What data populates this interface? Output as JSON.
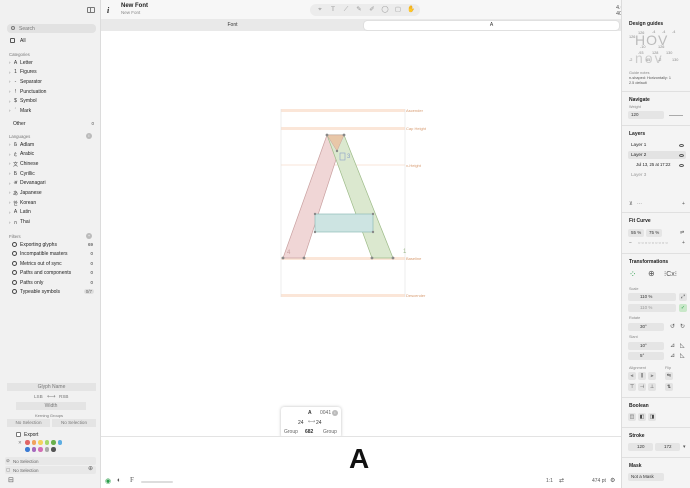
{
  "window": {
    "doc_title": "New Font",
    "doc_subtitle": "New Font",
    "zoom_range": "4.0-400%"
  },
  "tabs": [
    {
      "label": "Font"
    },
    {
      "label": "A"
    }
  ],
  "sidebar": {
    "search_placeholder": "Search",
    "all_label": "All",
    "categories_title": "Categories",
    "categories": [
      {
        "icon": "A",
        "label": "Letter"
      },
      {
        "icon": "1",
        "label": "Figures"
      },
      {
        "icon": "-",
        "label": "Separator"
      },
      {
        "icon": "!",
        "label": "Punctuation"
      },
      {
        "icon": "$",
        "label": "Symbol"
      },
      {
        "icon": "´",
        "label": "Mark"
      }
    ],
    "other_label": "Other",
    "other_count": "0",
    "languages_title": "Languages",
    "languages": [
      {
        "icon": "𞤀",
        "label": "Adlam"
      },
      {
        "icon": "ع",
        "label": "Arabic"
      },
      {
        "icon": "文",
        "label": "Chinese"
      },
      {
        "icon": "Б",
        "label": "Cyrillic"
      },
      {
        "icon": "अ",
        "label": "Devanagari"
      },
      {
        "icon": "あ",
        "label": "Japanese"
      },
      {
        "icon": "한",
        "label": "Korean"
      },
      {
        "icon": "A",
        "label": "Latin"
      },
      {
        "icon": "ก",
        "label": "Thai"
      }
    ],
    "filters_title": "Filters",
    "filters": [
      {
        "label": "Exporting glyphs",
        "count": "69"
      },
      {
        "label": "Incompatible masters",
        "count": "0"
      },
      {
        "label": "Metrics out of sync",
        "count": "0"
      },
      {
        "label": "Paths and components",
        "count": "0"
      },
      {
        "label": "Paths only",
        "count": "0"
      },
      {
        "label": "Typeable symbols",
        "count": "0/7"
      }
    ],
    "glyph_name_placeholder": "Glyph Name",
    "lsb_label": "LSB",
    "rsb_label": "RSB",
    "width_label": "Width",
    "kerning_groups_label": "Kerning Groups",
    "kerning_left": "No Selection",
    "kerning_right": "No Selection",
    "export_label": "Export",
    "swatch_colors": [
      "#e06666",
      "#f0a35e",
      "#f4d35e",
      "#a6d96a",
      "#6ab04c",
      "#5dade2",
      "#3b7bd4",
      "#a569bd",
      "#d46fb4",
      "#aaaaaa",
      "#555555"
    ],
    "no_selection_1": "No Selection",
    "no_selection_2": "No Selection"
  },
  "canvas": {
    "metrics": [
      {
        "label": "Ascender"
      },
      {
        "label": "Cap Height"
      },
      {
        "label": "x-Height"
      },
      {
        "label": "Baseline"
      },
      {
        "label": "Descender"
      }
    ],
    "node_label_1": "1",
    "node_label_2": "3",
    "node_label_3": "4"
  },
  "glyph_card": {
    "glyph": "A",
    "unicode": "0041",
    "lsb": "24",
    "rsb": "24",
    "left_group": "Group",
    "width": "682",
    "right_group": "Group"
  },
  "preview": {
    "glyph": "A",
    "size_label": "474 pt",
    "scale": "1:1"
  },
  "inspector": {
    "design_guides_title": "Design guides",
    "guides_sample_top": "HOV",
    "guides_sample_bottom": "nov",
    "guide_numbers": [
      "126",
      "126",
      "-4",
      "-4",
      "-4",
      "-10",
      "126",
      "-93",
      "128",
      "130",
      "-2",
      "45",
      "-2",
      "130"
    ],
    "guide_notes": [
      "Guide notes",
      "n-shaped: Horizontally: 1",
      "2.5 default"
    ],
    "navigate_title": "Navigate",
    "weight_label": "Weight",
    "weight_value": "120",
    "layers_title": "Layers",
    "layers": [
      {
        "label": "Layer 1"
      },
      {
        "label": "Layer 2"
      },
      {
        "label": "Jul 13, 25 at 17:22"
      },
      {
        "label": "Layer 3"
      }
    ],
    "fit_curve_title": "Fit Curve",
    "fit_curve_values": [
      "55 %",
      "75 %"
    ],
    "transformations_title": "Transformations",
    "scale_label": "Scale",
    "scale_values": [
      "110 %",
      "110 %"
    ],
    "rotate_label": "Rotate",
    "rotate_value": "30°",
    "slant_label": "Slant",
    "slant_values": [
      "10°",
      "5°"
    ],
    "alignment_label": "Alignment",
    "flip_label": "Flip",
    "boolean_title": "Boolean",
    "stroke_title": "Stroke",
    "stroke_values": [
      "120",
      "172"
    ],
    "mask_title": "Mask",
    "mask_value": "Not a Mask"
  },
  "colors": {
    "accent_blue": "#3b7bd4",
    "metric_line": "#f0b088",
    "left_stroke": "#e4b4b4",
    "right_stroke": "#b8d4a4",
    "crossbar": "#a8d4d4"
  }
}
